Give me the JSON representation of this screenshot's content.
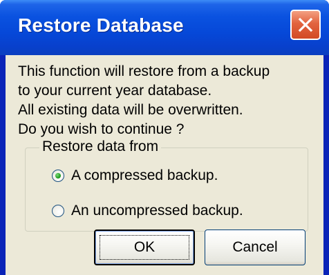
{
  "window": {
    "title": "Restore Database",
    "close_icon": "close-icon"
  },
  "message": {
    "lines": [
      "This function will restore from a backup",
      "to your current year database.",
      "All existing data will be overwritten.",
      "Do you wish to continue ?"
    ]
  },
  "restore_group": {
    "legend": "Restore data from",
    "options": [
      {
        "label": "A compressed backup.",
        "selected": true
      },
      {
        "label": "An uncompressed backup.",
        "selected": false
      }
    ]
  },
  "buttons": {
    "ok_label": "OK",
    "cancel_label": "Cancel"
  },
  "colors": {
    "titlebar_blue": "#0648d8",
    "close_red": "#d24a24",
    "dialog_face": "#ece9d8",
    "radio_green": "#21a121"
  }
}
